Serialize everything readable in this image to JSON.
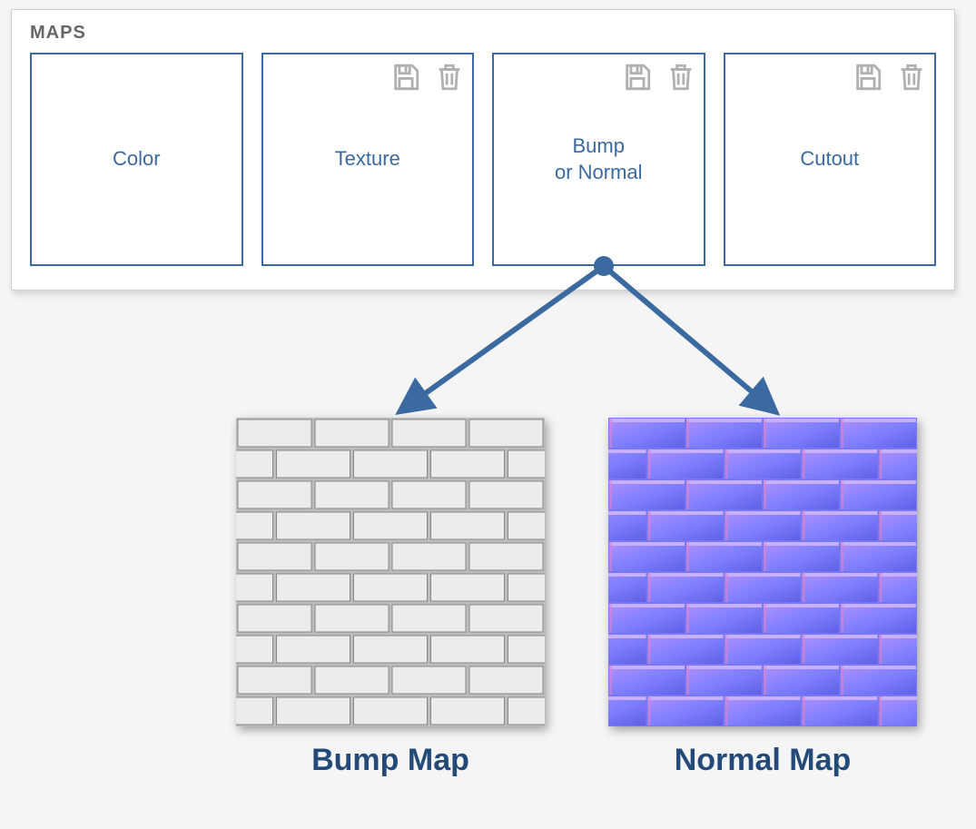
{
  "panel": {
    "title": "MAPS",
    "slots": [
      {
        "label": "Color",
        "hasIcons": false
      },
      {
        "label": "Texture",
        "hasIcons": true
      },
      {
        "label": "Bump\nor Normal",
        "hasIcons": true
      },
      {
        "label": "Cutout",
        "hasIcons": true
      }
    ]
  },
  "samples": [
    {
      "caption": "Bump Map"
    },
    {
      "caption": "Normal Map"
    }
  ],
  "colors": {
    "accent": "#3a6aa0",
    "title": "#244a78"
  }
}
